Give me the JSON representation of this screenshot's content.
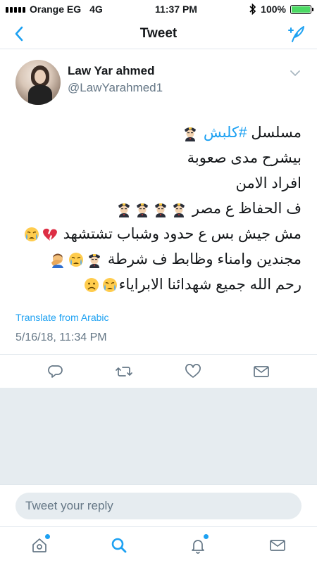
{
  "status_bar": {
    "carrier": "Orange EG",
    "network": "4G",
    "time": "11:37 PM",
    "battery": "100%",
    "battery_level": 1.0
  },
  "nav": {
    "title": "Tweet",
    "back_icon": "chevron-left-icon",
    "compose_icon": "compose-feather-icon"
  },
  "tweet": {
    "author_name": "Law Yar ahmed",
    "author_handle": "@LawYarahmed1",
    "lines": {
      "l1_text": "مسلسل ",
      "l1_hashtag": "#كلبش",
      "l2": "بيشرح مدى صعوبة",
      "l3": "افراد الامن",
      "l4": "ف الحفاظ ع مصر",
      "l5": "مش جيش بس ع حدود وشباب تشتشهد",
      "l6": "مجندين وامناء وظابط ف شرطة",
      "l7": "رحم الله جميع شهدائنا الابراياء"
    },
    "translate_label": "Translate from Arabic",
    "timestamp": "5/16/18, 11:34 PM"
  },
  "reply": {
    "placeholder": "Tweet your reply"
  },
  "tabbar": {
    "items": [
      "home-icon",
      "search-icon",
      "notifications-icon",
      "messages-icon"
    ]
  },
  "colors": {
    "accent": "#1da1f2",
    "secondary_text": "#657786",
    "divider": "#e1e8ed",
    "filler": "#e6ecf0"
  }
}
